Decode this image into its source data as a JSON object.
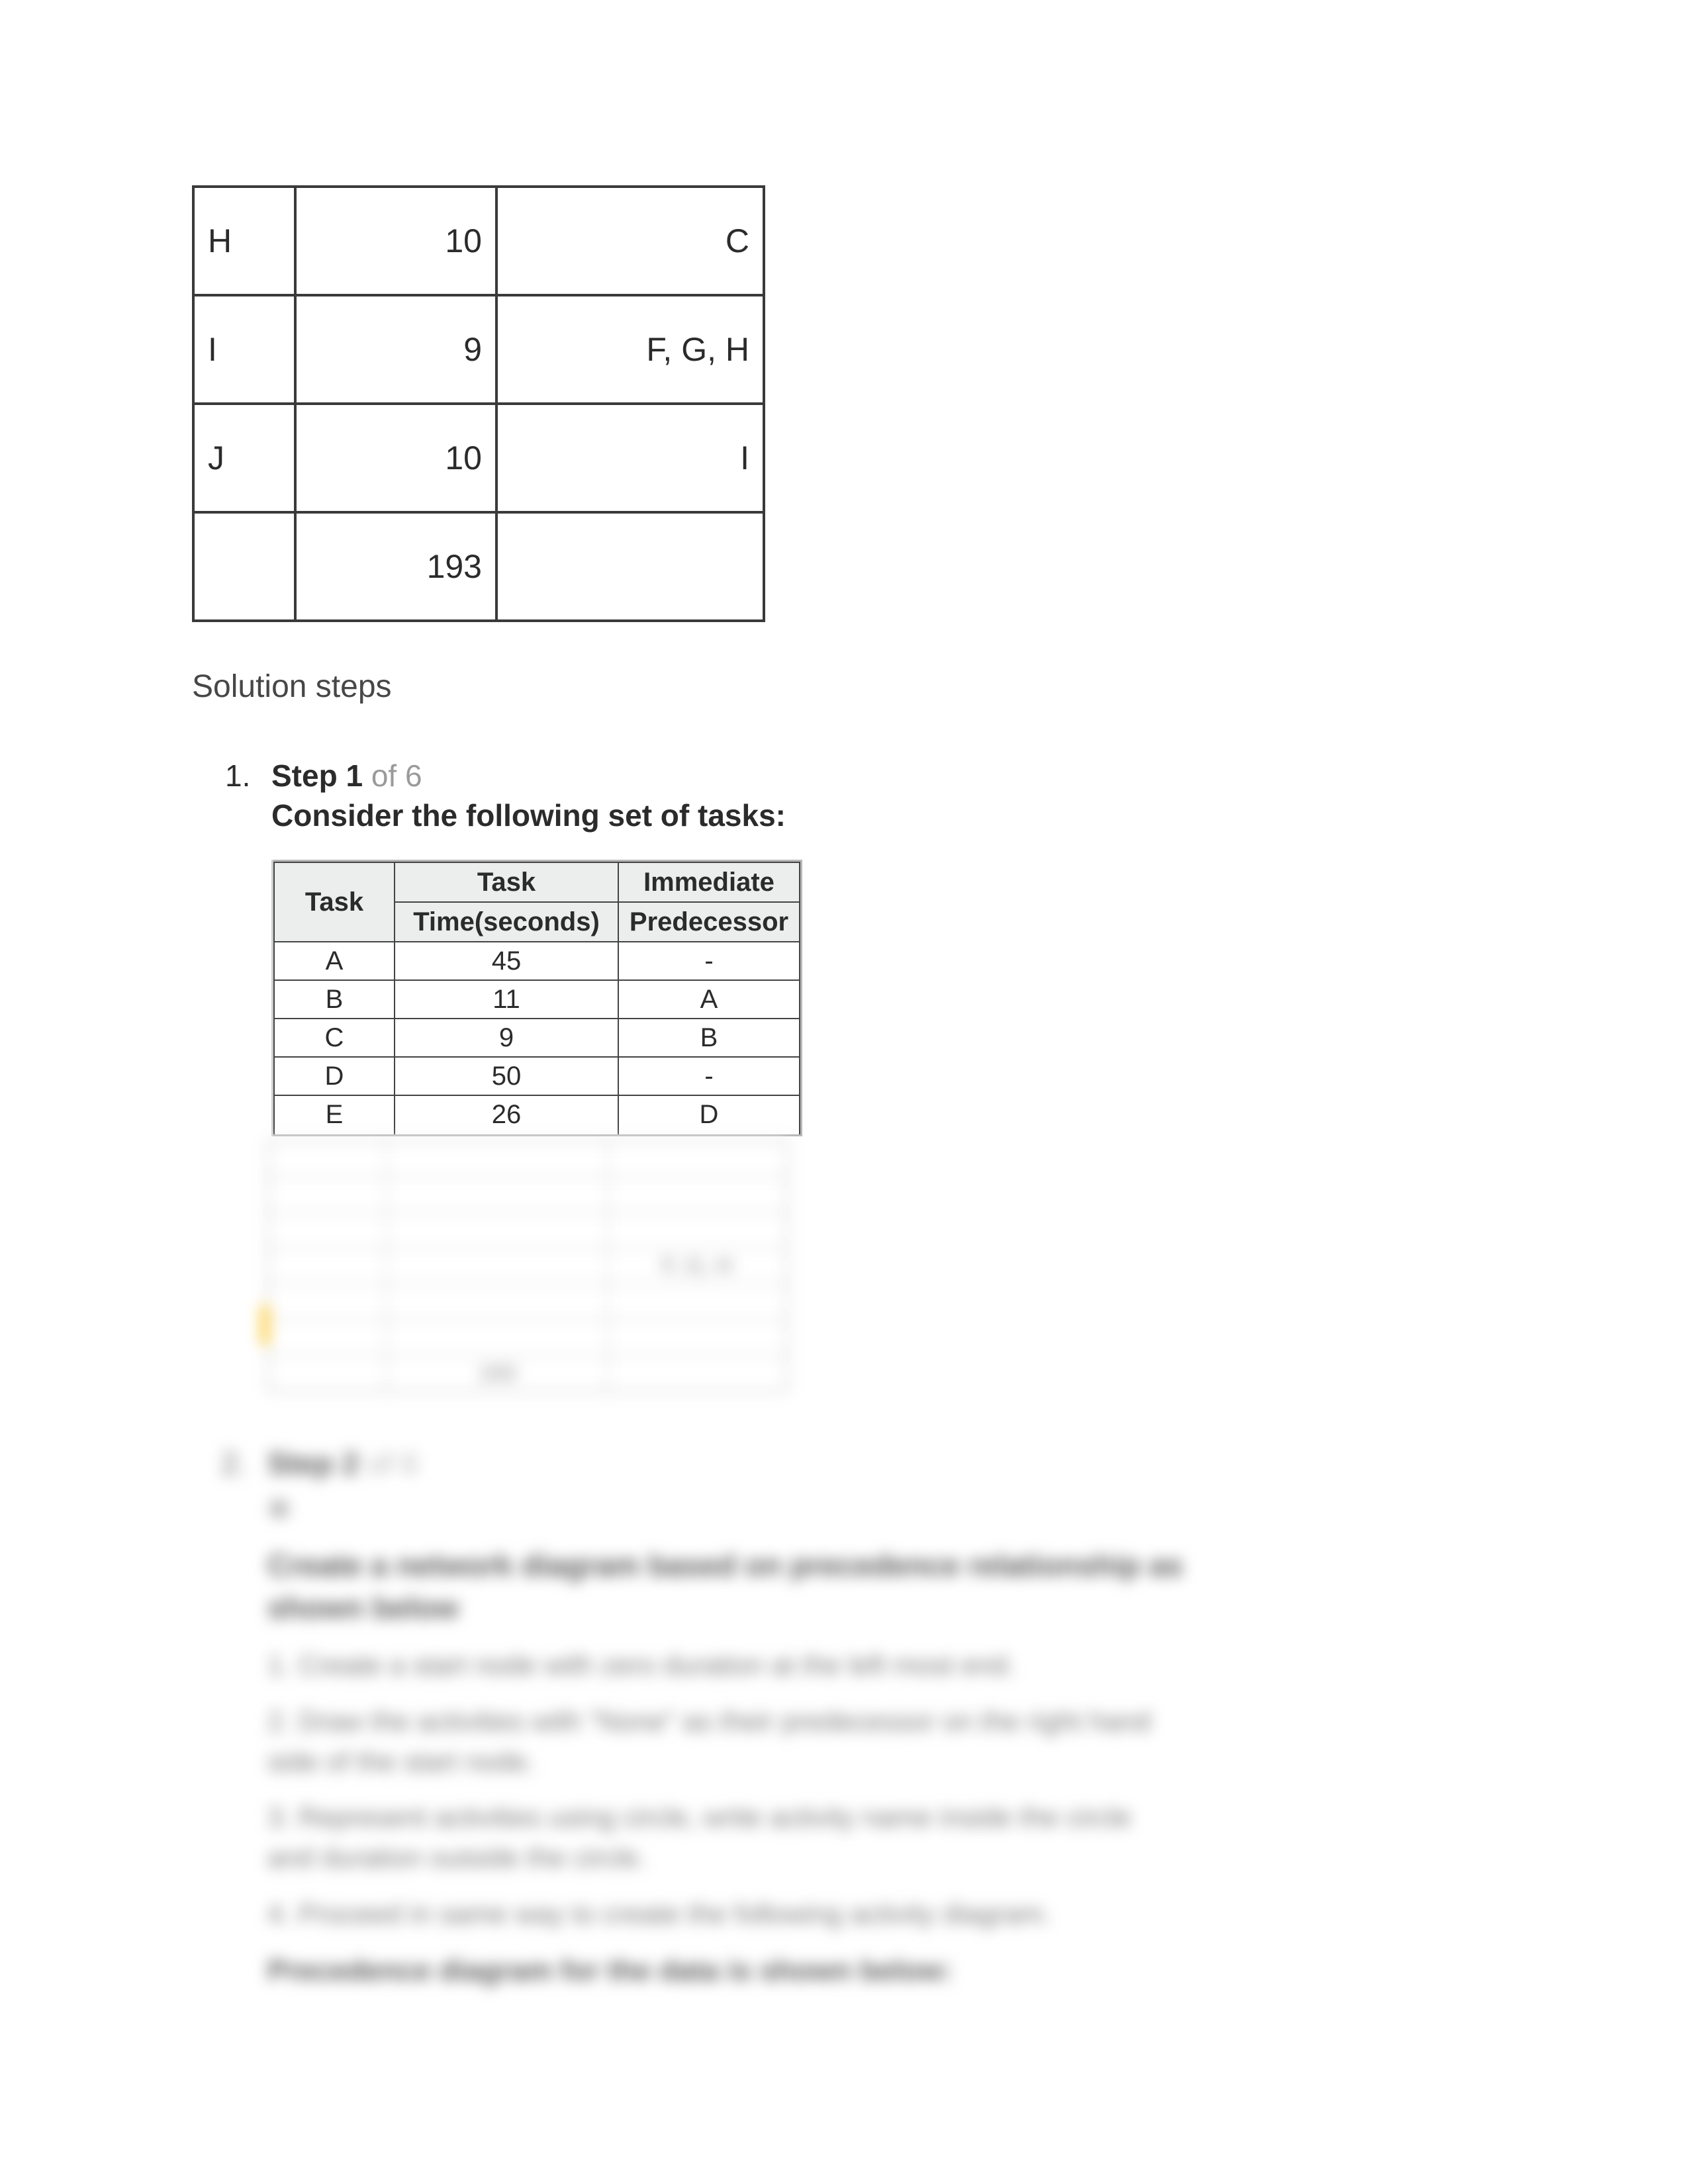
{
  "top_table": {
    "rows": [
      {
        "task": "H",
        "time": "10",
        "pred": "C"
      },
      {
        "task": "I",
        "time": "9",
        "pred": "F, G, H"
      },
      {
        "task": "J",
        "time": "10",
        "pred": "I"
      },
      {
        "task": "",
        "time": "193",
        "pred": ""
      }
    ]
  },
  "solution_steps_label": "Solution steps",
  "step1": {
    "number": "1.",
    "label_bold": "Step 1",
    "label_light": " of 6",
    "subtitle": "Consider the following set of tasks:",
    "sheet": {
      "headers": {
        "task": "Task",
        "time_l1": "Task",
        "time_l2": "Time(seconds)",
        "pred_l1": "Immediate",
        "pred_l2": "Predecessor"
      },
      "rows": [
        {
          "task": "A",
          "time": "45",
          "pred": "-"
        },
        {
          "task": "B",
          "time": "11",
          "pred": "A"
        },
        {
          "task": "C",
          "time": "9",
          "pred": "B"
        },
        {
          "task": "D",
          "time": "50",
          "pred": "-"
        }
      ],
      "partial_row": {
        "task": "E",
        "time": "26",
        "pred": "D"
      }
    }
  },
  "blurred": {
    "step_marker": "2.",
    "step_head_bold": "Step 2",
    "step_head_light": " of 6",
    "heading_l1": "Create a network diagram based on precedence relationship as",
    "heading_l2": "shown below",
    "line1": "1. Create a start node with zero duration at the left most end.",
    "line2a": "2. Draw the activities with \"None\" as their predecessor on the right hand",
    "line2b": "side of the start node.",
    "line3a": "3. Represent activities using circle, write activity name inside the circle",
    "line3b": "and duration outside the circle.",
    "line4": "4. Proceed in same way to create the following activity diagram.",
    "bottom": "Precedence diagram for the data is shown below:"
  }
}
